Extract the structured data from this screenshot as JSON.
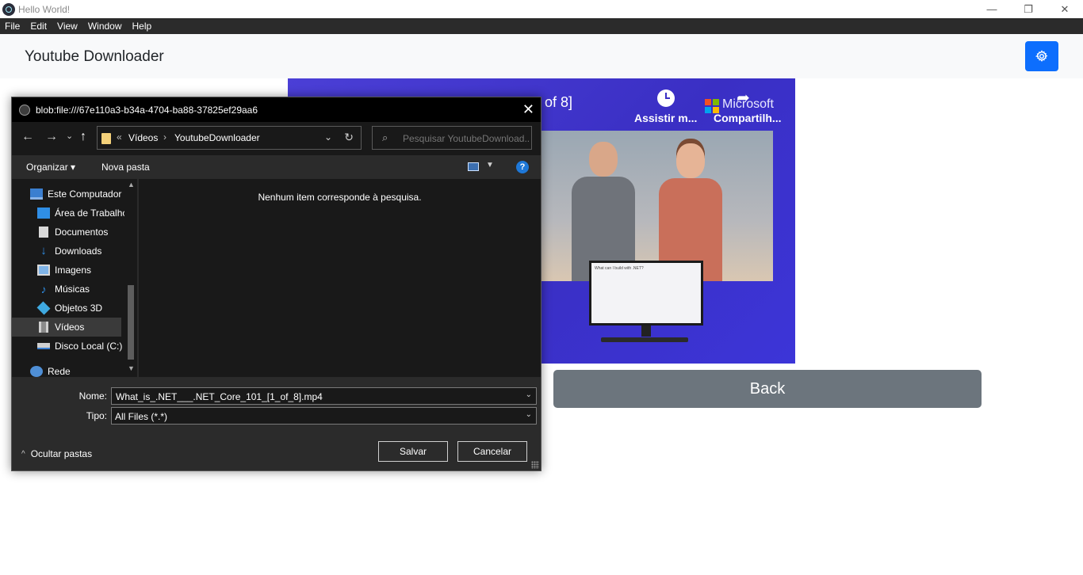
{
  "window": {
    "title": "Hello World!",
    "controls": {
      "minimize": "—",
      "restore": "❐",
      "close": "✕"
    }
  },
  "menubar": {
    "items": [
      "File",
      "Edit",
      "View",
      "Window",
      "Help"
    ]
  },
  "header": {
    "title": "Youtube Downloader",
    "settings_icon": "gear-icon",
    "accent": "#0d6efd"
  },
  "video": {
    "title_fragment": "of 8]",
    "watch_later_label": "Assistir m...",
    "share_label": "Compartilh...",
    "brand": "Microsoft",
    "monitor_text": "What can I build with .NET?"
  },
  "back_button": {
    "label": "Back",
    "color": "#6c757d"
  },
  "dialog": {
    "title": "blob:file:///67e110a3-b34a-4704-ba88-37825ef29aa6",
    "close": "✕",
    "nav": {
      "back": "←",
      "forward": "→",
      "recent": "⌄",
      "up": "↑"
    },
    "address": {
      "overflow": "«",
      "crumbs": [
        "Vídeos",
        "YoutubeDownloader"
      ],
      "separator": "›",
      "dropdown": "⌄",
      "refresh": "↻"
    },
    "search": {
      "placeholder": "Pesquisar YoutubeDownload...",
      "icon": "⌕"
    },
    "toolbar": {
      "organize": "Organizar ▾",
      "new_folder": "Nova pasta",
      "view_dropdown": "▼",
      "help": "?"
    },
    "nav_pane": {
      "items": [
        {
          "label": "Este Computador",
          "icon": "computer-icon"
        },
        {
          "label": "Área de Trabalhc",
          "icon": "desktop-icon"
        },
        {
          "label": "Documentos",
          "icon": "documents-icon"
        },
        {
          "label": "Downloads",
          "icon": "downloads-icon"
        },
        {
          "label": "Imagens",
          "icon": "pictures-icon"
        },
        {
          "label": "Músicas",
          "icon": "music-icon"
        },
        {
          "label": "Objetos 3D",
          "icon": "3d-objects-icon"
        },
        {
          "label": "Vídeos",
          "icon": "videos-icon",
          "selected": true
        },
        {
          "label": "Disco Local (C:)",
          "icon": "drive-icon"
        },
        {
          "label": "Rede",
          "icon": "network-icon"
        }
      ],
      "scroll_up": "▲",
      "scroll_down": "▼"
    },
    "empty_message": "Nenhum item corresponde à pesquisa.",
    "filename": {
      "label": "Nome:",
      "value": "What_is_.NET___.NET_Core_101_[1_of_8].mp4",
      "dropdown": "⌄"
    },
    "filetype": {
      "label": "Tipo:",
      "value": "All Files (*.*)",
      "dropdown": "⌄"
    },
    "save_label": "Salvar",
    "cancel_label": "Cancelar",
    "hide_folders_label": "Ocultar pastas",
    "hide_folders_chevron": "^"
  }
}
